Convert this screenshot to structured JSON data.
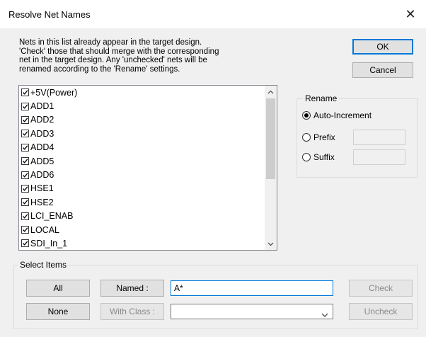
{
  "window": {
    "title": "Resolve Net Names",
    "close_glyph": "✕"
  },
  "description": "Nets in this list already appear in the target design.\n'Check' those that should merge with the corresponding\nnet in the target design. Any 'unchecked' nets will be\nrenamed according to the 'Rename' settings.",
  "buttons": {
    "ok": "OK",
    "cancel": "Cancel"
  },
  "nets": [
    {
      "name": "+5V(Power)",
      "checked": true
    },
    {
      "name": "ADD1",
      "checked": true
    },
    {
      "name": "ADD2",
      "checked": true
    },
    {
      "name": "ADD3",
      "checked": true
    },
    {
      "name": "ADD4",
      "checked": true
    },
    {
      "name": "ADD5",
      "checked": true
    },
    {
      "name": "ADD6",
      "checked": true
    },
    {
      "name": "HSE1",
      "checked": true
    },
    {
      "name": "HSE2",
      "checked": true
    },
    {
      "name": "LCI_ENAB",
      "checked": true
    },
    {
      "name": "LOCAL",
      "checked": true
    },
    {
      "name": "SDI_In_1",
      "checked": true
    }
  ],
  "rename": {
    "label": "Rename",
    "options": [
      {
        "label": "Auto-Increment",
        "selected": true
      },
      {
        "label": "Prefix",
        "selected": false
      },
      {
        "label": "Suffix",
        "selected": false
      }
    ],
    "prefix_value": "",
    "suffix_value": ""
  },
  "select_items": {
    "label": "Select Items",
    "all": "All",
    "none": "None",
    "named": "Named :",
    "with_class": "With Class :",
    "named_value": "A*",
    "class_value": "",
    "check": "Check",
    "uncheck": "Uncheck"
  },
  "icons": {
    "scroll_up": "scroll-up-icon",
    "scroll_down": "scroll-down-icon",
    "dropdown": "chevron-down-icon"
  }
}
